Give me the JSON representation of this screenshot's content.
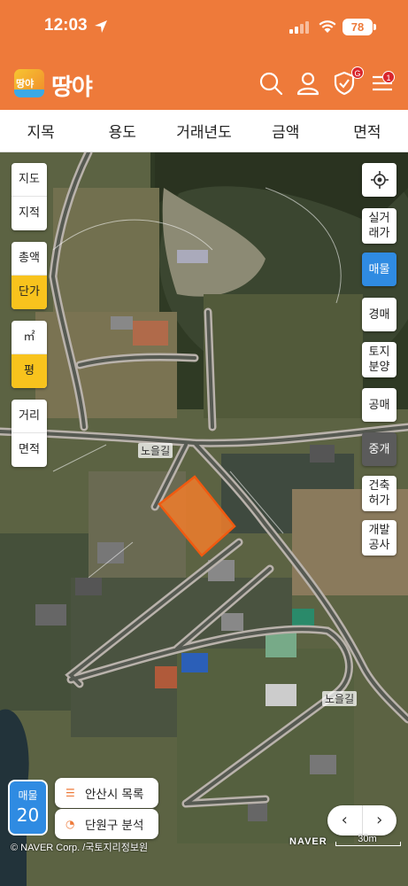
{
  "status_bar": {
    "time": "12:03",
    "battery": "78"
  },
  "header": {
    "logo_icon_text": "땅야",
    "logo_text": "땅야",
    "shield_badge": "G",
    "menu_badge": "1",
    "icons": [
      "search-icon",
      "user-icon",
      "shield-icon",
      "menu-icon"
    ]
  },
  "tabs": [
    "지목",
    "용도",
    "거래년도",
    "금액",
    "면적"
  ],
  "left_controls": {
    "map_type": [
      "지도",
      "지적"
    ],
    "price_type": [
      "총액",
      "단가"
    ],
    "unit": [
      "㎡",
      "평"
    ],
    "measure": [
      "거리",
      "면적"
    ],
    "active": [
      "단가",
      "평"
    ]
  },
  "right_controls": {
    "location": "current-location-icon",
    "layers": [
      "실거\n래가",
      "매물",
      "경매",
      "토지\n분양",
      "공매",
      "중개",
      "건축\n허가",
      "개발\n공사"
    ],
    "active": "매물",
    "dark": "중개"
  },
  "road_labels": [
    "노을길",
    "노을길"
  ],
  "bottom": {
    "listing_label": "매물",
    "listing_count": "20",
    "list_button": "안산시 목록",
    "analysis_button": "단원구 분석",
    "prev": "‹",
    "next": "›",
    "copyright": "© NAVER Corp.  /국토지리정보원",
    "naver_logo": "NAVER",
    "scale": "30m"
  },
  "colors": {
    "accent": "#ee7a3a",
    "active_yellow": "#f8c31d",
    "blue": "#2f8be2",
    "parcel": "#f07c2c"
  }
}
